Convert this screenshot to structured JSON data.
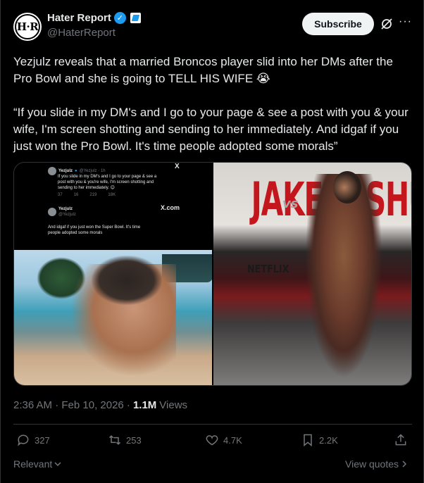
{
  "account": {
    "avatar_text": "H·R",
    "name": "Hater Report",
    "handle": "@HaterReport",
    "verified_icon": "verified-badge-icon",
    "affiliate_icon": "affiliate-badge-icon"
  },
  "header": {
    "subscribe_label": "Subscribe",
    "more_label": "···"
  },
  "tweet": {
    "paragraph_1": "Yezjulz reveals that a married Broncos player slid into her DMs after the Pro Bowl and she is going to TELL HIS WIFE 😭",
    "paragraph_2": "“If you slide in my DM's and I go to your page & see a post with you & your wife, I'm screen shotting and sending to her immediately. And idgaf if you just won the Pro Bowl. It's time people adopted some morals”"
  },
  "media": {
    "left_screenshot": {
      "post_1_name": "Yezjulz",
      "post_1_handle": "@Yezjulz · 1h",
      "post_1_text": "If you slide in my DM's and I go to your page & see a post with you & you're wife, I'm screen shotting and sending to her immediately. 😊",
      "post_1_stats": [
        "37",
        "16",
        "219",
        "18K"
      ],
      "x_mark": "X",
      "post_2_name": "Yezjulz",
      "post_2_handle": "@Yezjulz",
      "xcom_label": "X.com",
      "post_2_text": "And idgaf if you just won the Super Bowl. It's time people adopted some morals"
    },
    "right_photo": {
      "backdrop_text": "JAKE JOSHUA",
      "vs_text": "vs",
      "brand_text": "NETFLIX"
    }
  },
  "meta": {
    "timestamp": "2:36 AM · Feb 10, 2026 · ",
    "views_count": "1.1M",
    "views_label": "Views"
  },
  "actions": {
    "replies": "327",
    "reposts": "253",
    "likes": "4.7K",
    "bookmarks": "2.2K"
  },
  "footer": {
    "relevant_label": "Relevant",
    "view_quotes_label": "View quotes"
  },
  "colors": {
    "background": "#000000",
    "text": "#e7e9ea",
    "muted": "#71767b",
    "verified": "#1d9bf0",
    "border": "#2f3336"
  }
}
